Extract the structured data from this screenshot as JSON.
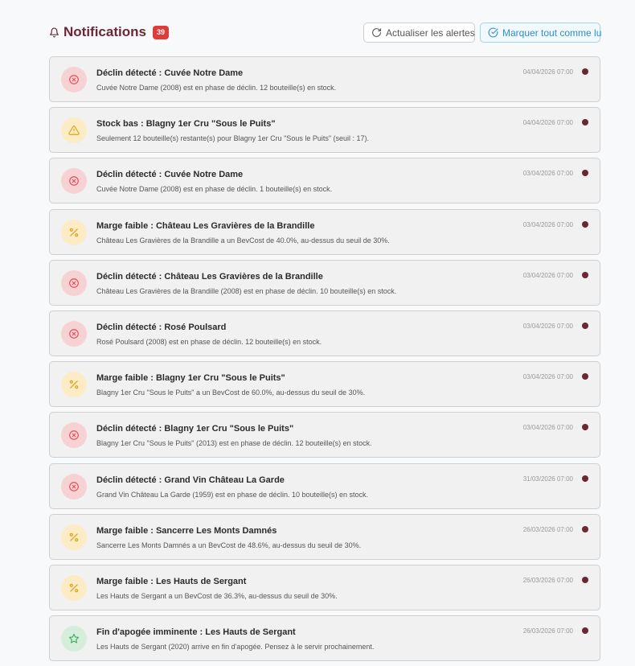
{
  "header": {
    "title": "Notifications",
    "count": "39",
    "refresh_label": "Actualiser les alertes",
    "mark_all_label": "Marquer tout comme lu"
  },
  "colors": {
    "brand": "#6b2735",
    "badge": "#e03b3b",
    "accent": "#2c8fc9",
    "unread_dot": "#6b2735"
  },
  "notifications": [
    {
      "type": "decline",
      "icon": "x-circle-icon",
      "title": "Déclin détecté : Cuvée Notre Dame",
      "description": "Cuvée Notre Dame (2008) est en phase de déclin. 12 bouteille(s) en stock.",
      "time": "04/04/2026 07:00",
      "unread": true
    },
    {
      "type": "low-stock",
      "icon": "warning-icon",
      "title": "Stock bas : Blagny 1er Cru \"Sous le Puits\"",
      "description": "Seulement 12 bouteille(s) restante(s) pour Blagny 1er Cru \"Sous le Puits\" (seuil : 17).",
      "time": "04/04/2026 07:00",
      "unread": true
    },
    {
      "type": "decline",
      "icon": "x-circle-icon",
      "title": "Déclin détecté : Cuvée Notre Dame",
      "description": "Cuvée Notre Dame (2008) est en phase de déclin. 1 bouteille(s) en stock.",
      "time": "03/04/2026 07:00",
      "unread": true
    },
    {
      "type": "margin",
      "icon": "percent-icon",
      "title": "Marge faible : Château Les Gravières de la Brandille",
      "description": "Château Les Gravières de la Brandille a un BevCost de 40.0%, au-dessus du seuil de 30%.",
      "time": "03/04/2026 07:00",
      "unread": true
    },
    {
      "type": "decline",
      "icon": "x-circle-icon",
      "title": "Déclin détecté : Château Les Gravières de la Brandille",
      "description": "Château Les Gravières de la Brandille (2008) est en phase de déclin. 10 bouteille(s) en stock.",
      "time": "03/04/2026 07:00",
      "unread": true
    },
    {
      "type": "decline",
      "icon": "x-circle-icon",
      "title": "Déclin détecté : Rosé Poulsard",
      "description": "Rosé Poulsard (2008) est en phase de déclin. 12 bouteille(s) en stock.",
      "time": "03/04/2026 07:00",
      "unread": true
    },
    {
      "type": "margin",
      "icon": "percent-icon",
      "title": "Marge faible : Blagny 1er Cru \"Sous le Puits\"",
      "description": "Blagny 1er Cru \"Sous le Puits\" a un BevCost de 60.0%, au-dessus du seuil de 30%.",
      "time": "03/04/2026 07:00",
      "unread": true
    },
    {
      "type": "decline",
      "icon": "x-circle-icon",
      "title": "Déclin détecté : Blagny 1er Cru \"Sous le Puits\"",
      "description": "Blagny 1er Cru \"Sous le Puits\" (2013) est en phase de déclin. 12 bouteille(s) en stock.",
      "time": "03/04/2026 07:00",
      "unread": true
    },
    {
      "type": "decline",
      "icon": "x-circle-icon",
      "title": "Déclin détecté : Grand Vin Château La Garde",
      "description": "Grand Vin Château La Garde (1959) est en phase de déclin. 10 bouteille(s) en stock.",
      "time": "31/03/2026 07:00",
      "unread": true
    },
    {
      "type": "margin",
      "icon": "percent-icon",
      "title": "Marge faible : Sancerre Les Monts Damnés",
      "description": "Sancerre Les Monts Damnés a un BevCost de 48.6%, au-dessus du seuil de 30%.",
      "time": "26/03/2026 07:00",
      "unread": true
    },
    {
      "type": "margin",
      "icon": "percent-icon",
      "title": "Marge faible : Les Hauts de Sergant",
      "description": "Les Hauts de Sergant a un BevCost de 36.3%, au-dessus du seuil de 30%.",
      "time": "26/03/2026 07:00",
      "unread": true
    },
    {
      "type": "peak",
      "icon": "star-icon",
      "title": "Fin d'apogée imminente : Les Hauts de Sergant",
      "description": "Les Hauts de Sergant (2020) arrive en fin d'apogée. Pensez à le servir prochainement.",
      "time": "26/03/2026 07:00",
      "unread": true
    }
  ]
}
